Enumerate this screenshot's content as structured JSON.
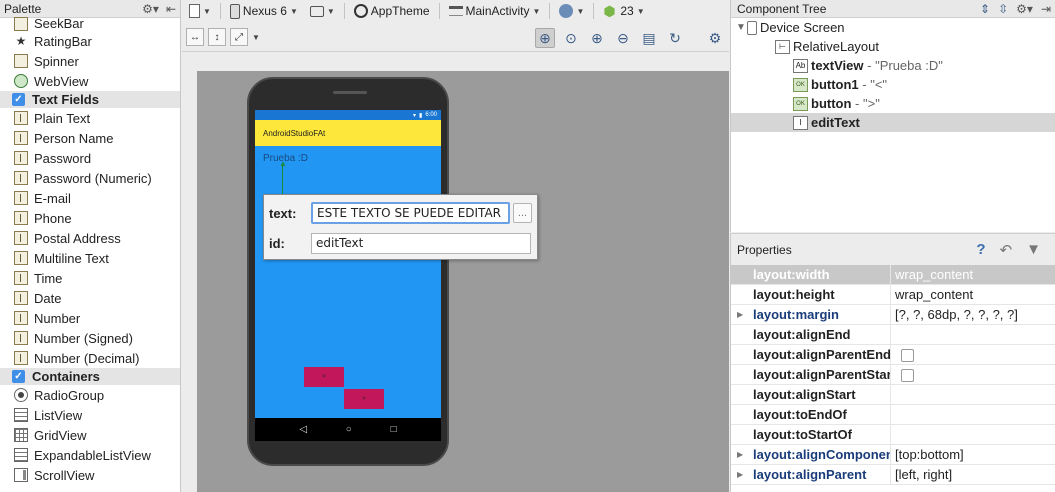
{
  "palette": {
    "title": "Palette",
    "items_top": [
      {
        "label": "SeekBar",
        "icon": "seekbar-icon"
      },
      {
        "label": "RatingBar",
        "icon": "star-icon"
      },
      {
        "label": "Spinner",
        "icon": "spinner-icon"
      },
      {
        "label": "WebView",
        "icon": "globe-icon"
      }
    ],
    "cat_text_fields": "Text Fields",
    "text_fields": [
      "Plain Text",
      "Person Name",
      "Password",
      "Password (Numeric)",
      "E-mail",
      "Phone",
      "Postal Address",
      "Multiline Text",
      "Time",
      "Date",
      "Number",
      "Number (Signed)",
      "Number (Decimal)"
    ],
    "cat_containers": "Containers",
    "containers": [
      {
        "label": "RadioGroup",
        "icon": "radio-icon"
      },
      {
        "label": "ListView",
        "icon": "list-icon"
      },
      {
        "label": "GridView",
        "icon": "grid-icon"
      },
      {
        "label": "ExpandableListView",
        "icon": "list-icon"
      },
      {
        "label": "ScrollView",
        "icon": "scroll-icon"
      }
    ]
  },
  "toolbar": {
    "device": "Nexus 6",
    "theme": "AppTheme",
    "activity": "MainActivity",
    "api": "23"
  },
  "device_preview": {
    "app_title": "AndroidStudioFAt",
    "status_time": "6:00",
    "textview_text": "Prueba :D",
    "button1_text": "<",
    "button2_text": ">",
    "nav_back": "◁",
    "nav_home": "○",
    "nav_recent": "□"
  },
  "popup": {
    "text_label": "text:",
    "text_value": "ESTE TEXTO SE PUEDE EDITAR",
    "ellipsis": "...",
    "id_label": "id:",
    "id_value": "editText"
  },
  "component_tree": {
    "title": "Component Tree",
    "nodes": [
      {
        "name": "Device Screen",
        "detail": ""
      },
      {
        "name": "RelativeLayout",
        "detail": ""
      },
      {
        "name": "textView",
        "detail": "- \"Prueba :D\""
      },
      {
        "name": "button1",
        "detail": "- \"<\""
      },
      {
        "name": "button",
        "detail": "- \">\""
      },
      {
        "name": "editText",
        "detail": ""
      }
    ]
  },
  "properties": {
    "title": "Properties",
    "rows": [
      {
        "name": "layout:width",
        "value": "wrap_content"
      },
      {
        "name": "layout:height",
        "value": "wrap_content"
      },
      {
        "name": "layout:margin",
        "value": "[?, ?, 68dp, ?, ?, ?, ?]"
      },
      {
        "name": "layout:alignEnd",
        "value": ""
      },
      {
        "name": "layout:alignParentEnd",
        "value": ""
      },
      {
        "name": "layout:alignParentStart",
        "value": ""
      },
      {
        "name": "layout:alignStart",
        "value": ""
      },
      {
        "name": "layout:toEndOf",
        "value": ""
      },
      {
        "name": "layout:toStartOf",
        "value": ""
      },
      {
        "name": "layout:alignComponent",
        "value": "[top:bottom]"
      },
      {
        "name": "layout:alignParent",
        "value": "[left, right]"
      }
    ]
  },
  "colors": {
    "accent": "#3f8ee8",
    "app_bar": "#fde73b",
    "screen": "#2196f3",
    "button": "#c2185b"
  }
}
